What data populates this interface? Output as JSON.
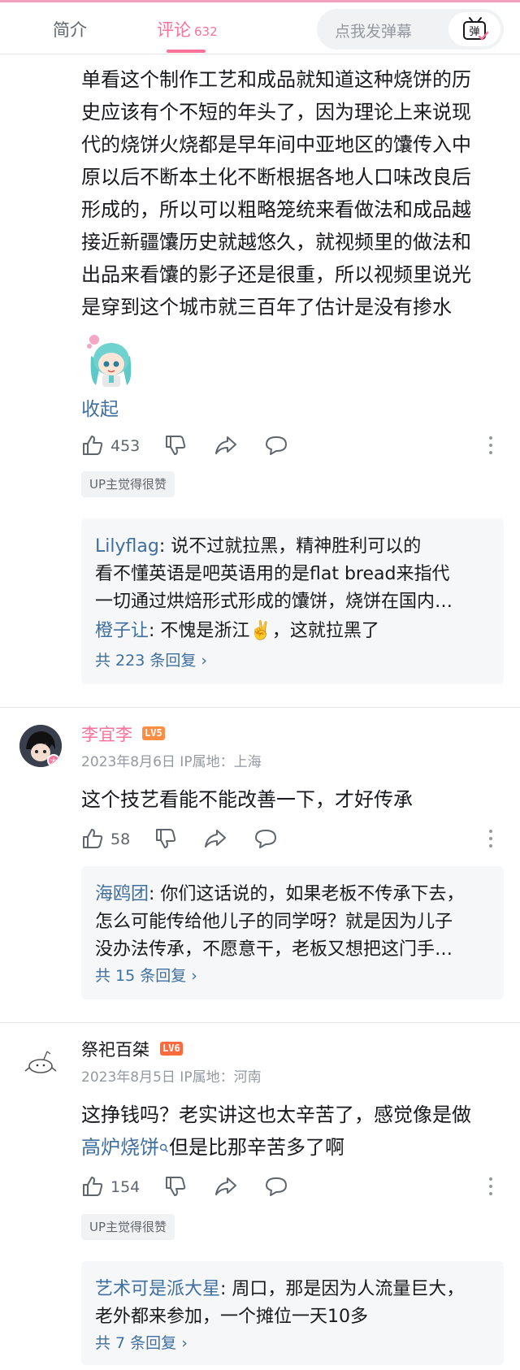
{
  "tabs": {
    "intro": "简介",
    "comments": "评论",
    "comment_count": "632",
    "danmaku_placeholder": "点我发弹幕",
    "danmaku_btn": "弹"
  },
  "comment1": {
    "lines": [
      "单看这个制作工艺和成品就知道这种烧饼的历",
      "史应该有个不短的年头了，因为理论上来说现",
      "代的烧饼火烧都是早年间中亚地区的馕传入中",
      "原以后不断本土化不断根据各地人口味改良后",
      "形成的，所以可以粗略笼统来看做法和成品越",
      "接近新疆馕历史就越悠久，就视频里的做法和",
      "出品来看馕的影子还是很重，所以视频里说光",
      "是穿到这个城市就三百年了估计是没有掺水"
    ],
    "collapse": "收起",
    "likes": "453",
    "tag": "UP主觉得很赞",
    "replies": [
      {
        "user": "Lilyflag",
        "text": ": 说不过就拉黑，精神胜利可以的"
      },
      {
        "user": "",
        "text": "看不懂英语是吧英语用的是flat bread来指代"
      },
      {
        "user": "",
        "text": "一切通过烘焙形式形成的馕饼，烧饼在国内…"
      },
      {
        "user": "橙子让",
        "text": ": 不愧是浙江✌️，这就拉黑了"
      }
    ],
    "more_replies": "共 223 条回复 ›"
  },
  "comment2": {
    "author": "李宜李",
    "level": "LV5",
    "meta": "2023年8月6日 IP属地：上海",
    "text": "这个技艺看能不能改善一下，才好传承",
    "likes": "58",
    "replies": [
      {
        "user": "海鸥团",
        "text": ": 你们这话说的，如果老板不传承下去，"
      },
      {
        "user": "",
        "text": "怎么可能传给他儿子的同学呀？就是因为儿子"
      },
      {
        "user": "",
        "text": "没办法传承，不愿意干，老板又想把这门手…"
      }
    ],
    "more_replies": "共 15 条回复 ›"
  },
  "comment3": {
    "author": "祭祀百桀",
    "level": "LV6",
    "meta": "2023年8月5日 IP属地：河南",
    "line1": "这挣钱吗？老实讲这也太辛苦了，感觉像是做",
    "keyword": "高炉烧饼",
    "line2_rest": "但是比那辛苦多了啊",
    "likes": "154",
    "tag": "UP主觉得很赞",
    "replies": [
      {
        "user": "艺术可是派大星",
        "text": ": 周口，那是因为人流量巨大，"
      },
      {
        "user": "",
        "text": "老外都来参加，一个摊位一天10多"
      }
    ],
    "more_replies": "共 7 条回复 ›"
  },
  "colors": {
    "brand_pink": "#fb7299",
    "link_blue": "#3f6f9f",
    "level_orange": "#ff8e44",
    "muted": "#9499a0"
  },
  "icons": [
    "like-icon",
    "dislike-icon",
    "share-icon",
    "reply-icon",
    "more-vertical-icon",
    "search-icon",
    "danmaku-tv-icon"
  ]
}
